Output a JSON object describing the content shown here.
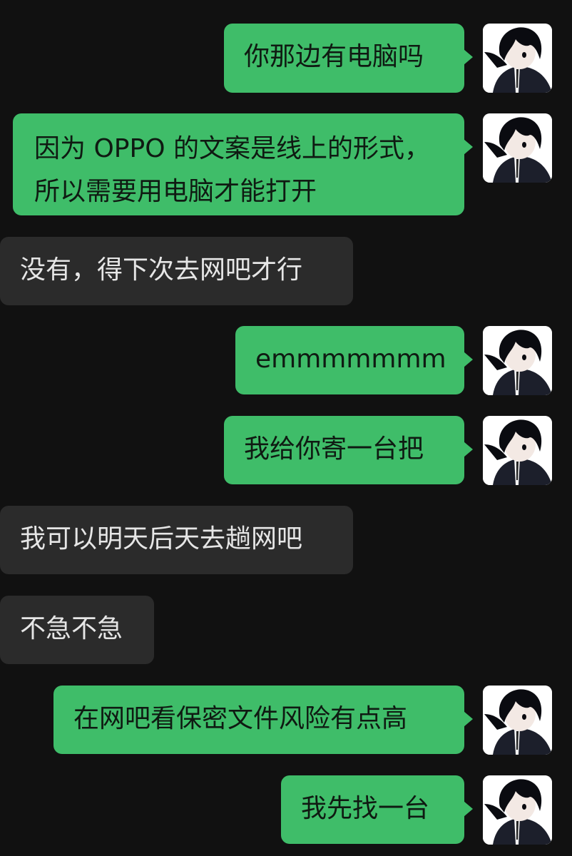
{
  "messages": [
    {
      "from": "me",
      "text": "你那边有电脑吗"
    },
    {
      "from": "me",
      "lines": [
        "因为 OPPO 的文案是线上的形式，",
        "所以需要用电脑才能打开"
      ]
    },
    {
      "from": "other",
      "text": "没有，得下次去网吧才行"
    },
    {
      "from": "me",
      "text": "emmmmmmm"
    },
    {
      "from": "me",
      "text": "我给你寄一台把"
    },
    {
      "from": "other",
      "text": "我可以明天后天去趟网吧"
    },
    {
      "from": "other",
      "text": "不急不急"
    },
    {
      "from": "me",
      "text": "在网吧看保密文件风险有点高"
    },
    {
      "from": "me",
      "text": "我先找一台"
    }
  ],
  "avatar_icon": "anime-boy-avatar-icon",
  "colors": {
    "background": "#111111",
    "outgoing_bubble": "#3fbd69",
    "incoming_bubble": "#2b2b2b",
    "incoming_text": "#e6e6e6"
  }
}
